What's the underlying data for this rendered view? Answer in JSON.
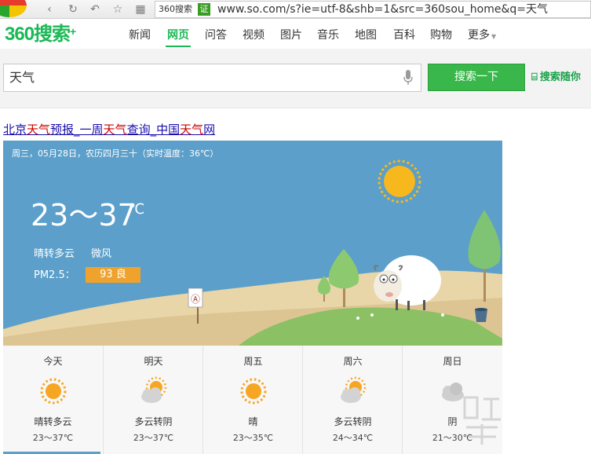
{
  "browser": {
    "address_chip": "360搜索",
    "address_badge": "证",
    "url": "www.so.com/s?ie=utf-8&shb=1&src=360sou_home&q=天气"
  },
  "nav": {
    "logo": "360搜索",
    "items": [
      "新闻",
      "网页",
      "问答",
      "视频",
      "图片",
      "音乐",
      "地图",
      "百科",
      "购物",
      "更多"
    ],
    "active": "网页"
  },
  "search": {
    "query": "天气",
    "button_label": "搜索一下",
    "side_link": "搜索随你"
  },
  "result": {
    "title_parts": [
      "北京",
      "天气",
      "预报_一周",
      "天气",
      "查询_中国",
      "天气",
      "网"
    ]
  },
  "weather": {
    "date_line": "周三，05月28日，农历四月三十（实时温度：36℃）",
    "temp_range": "23～37",
    "temp_unit": "℃",
    "condition": "晴转多云",
    "wind": "微风",
    "pm_label": "PM2.5：",
    "pm_value": "93 良",
    "sign_glyph": "Ⓐ"
  },
  "forecast": [
    {
      "day": "今天",
      "icon": "sun-icon",
      "cond": "晴转多云",
      "temp": "23～37℃"
    },
    {
      "day": "明天",
      "icon": "partly-cloudy-icon",
      "cond": "多云转阴",
      "temp": "23～37℃"
    },
    {
      "day": "周五",
      "icon": "sun-icon",
      "cond": "晴",
      "temp": "23～35℃"
    },
    {
      "day": "周六",
      "icon": "partly-cloudy-icon",
      "cond": "多云转阴",
      "temp": "24～34℃"
    },
    {
      "day": "周日",
      "icon": "cloud-icon",
      "cond": "阴",
      "temp": "21～30℃"
    }
  ],
  "colors": {
    "brand_green": "#19b955",
    "card_sky": "#5b9fca",
    "pm_badge": "#f0a32c",
    "link": "#1a0dab",
    "highlight": "#cc0000"
  }
}
